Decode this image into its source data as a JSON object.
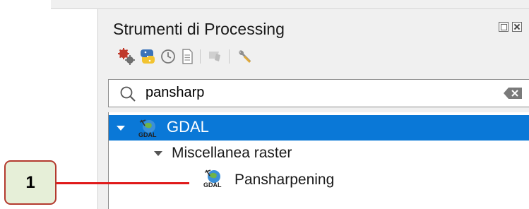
{
  "panel": {
    "title": "Strumenti di Processing"
  },
  "toolbar": {
    "icons": [
      "models-gear-icon",
      "python-icon",
      "history-clock-icon",
      "results-document-icon",
      "edit-features-icon",
      "settings-wrench-icon"
    ]
  },
  "search": {
    "value": "pansharp"
  },
  "tree": {
    "provider_label": "GDAL",
    "group_label": "Miscellanea raster",
    "algorithm_label": "Pansharpening"
  },
  "callout": {
    "number": "1"
  },
  "colors": {
    "selection": "#0a78d7",
    "callout_border": "#b33a2e",
    "callout_fill": "#e6efd8",
    "callout_line": "#e01a1a"
  }
}
